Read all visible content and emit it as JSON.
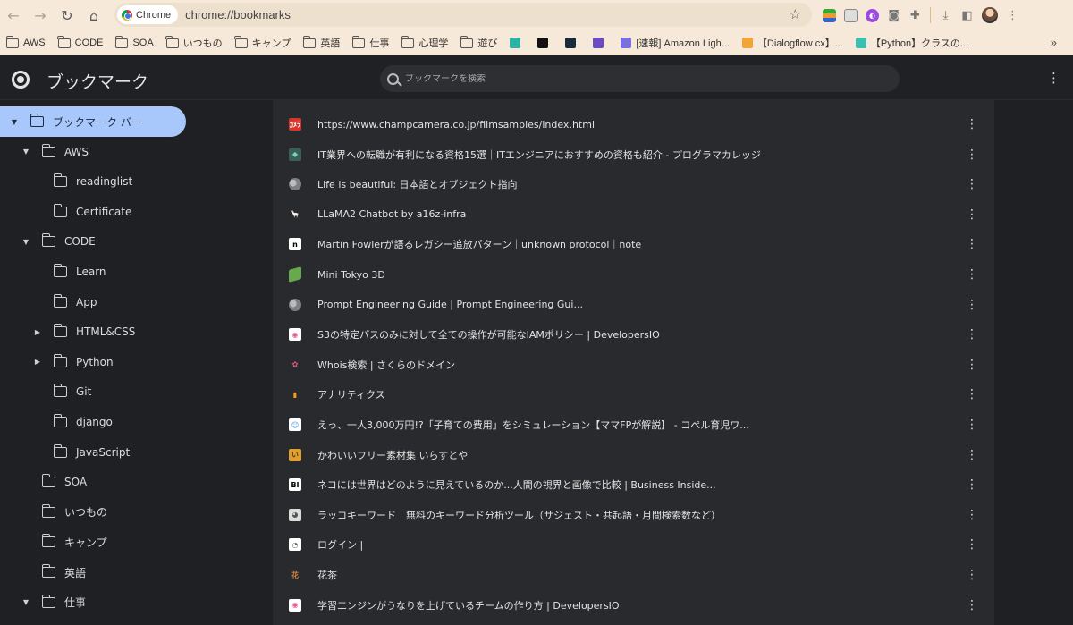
{
  "browser": {
    "chip_label": "Chrome",
    "url": "chrome://bookmarks"
  },
  "bookmarks_bar": [
    {
      "label": "AWS",
      "type": "folder"
    },
    {
      "label": "CODE",
      "type": "folder"
    },
    {
      "label": "SOA",
      "type": "folder"
    },
    {
      "label": "いつもの",
      "type": "folder"
    },
    {
      "label": "キャンプ",
      "type": "folder"
    },
    {
      "label": "英語",
      "type": "folder"
    },
    {
      "label": "仕事",
      "type": "folder"
    },
    {
      "label": "心理学",
      "type": "folder"
    },
    {
      "label": "遊び",
      "type": "folder"
    },
    {
      "label": "",
      "type": "icon",
      "color": "#2bb3a0"
    },
    {
      "label": "",
      "type": "icon",
      "color": "#111111"
    },
    {
      "label": "",
      "type": "icon",
      "color": "#1b2a3a"
    },
    {
      "label": "",
      "type": "icon",
      "color": "#6a4bc2"
    },
    {
      "label": "[速報] Amazon Ligh...",
      "type": "icon",
      "color": "#7a6ee0"
    },
    {
      "label": "【Dialogflow cx】...",
      "type": "icon",
      "color": "#f2a33a"
    },
    {
      "label": "【Python】クラスの...",
      "type": "icon",
      "color": "#3cbfae"
    }
  ],
  "header": {
    "title": "ブックマーク",
    "search_placeholder": "ブックマークを検索"
  },
  "tree": [
    {
      "label": "ブックマーク バー",
      "level": 0,
      "arrow": "▼",
      "selected": true
    },
    {
      "label": "AWS",
      "level": 1,
      "arrow": "▼",
      "selected": false
    },
    {
      "label": "readinglist",
      "level": 2,
      "arrow": "",
      "selected": false
    },
    {
      "label": "Certificate",
      "level": 2,
      "arrow": "",
      "selected": false
    },
    {
      "label": "CODE",
      "level": 1,
      "arrow": "▼",
      "selected": false
    },
    {
      "label": "Learn",
      "level": 2,
      "arrow": "",
      "selected": false
    },
    {
      "label": "App",
      "level": 2,
      "arrow": "",
      "selected": false
    },
    {
      "label": "HTML&CSS",
      "level": 2,
      "arrow": "▶",
      "selected": false
    },
    {
      "label": "Python",
      "level": 2,
      "arrow": "▶",
      "selected": false
    },
    {
      "label": "Git",
      "level": 2,
      "arrow": "",
      "selected": false
    },
    {
      "label": "django",
      "level": 2,
      "arrow": "",
      "selected": false
    },
    {
      "label": "JavaScript",
      "level": 2,
      "arrow": "",
      "selected": false
    },
    {
      "label": "SOA",
      "level": 1,
      "arrow": "",
      "selected": false
    },
    {
      "label": "いつもの",
      "level": 1,
      "arrow": "",
      "selected": false
    },
    {
      "label": "キャンプ",
      "level": 1,
      "arrow": "",
      "selected": false
    },
    {
      "label": "英語",
      "level": 1,
      "arrow": "",
      "selected": false
    },
    {
      "label": "仕事",
      "level": 1,
      "arrow": "▼",
      "selected": false
    }
  ],
  "list": [
    {
      "title": "https://www.champcamera.co.jp/filmsamples/index.html",
      "icon": "champ-camera-icon",
      "color": "#d8342b",
      "glyph": "ｶﾒﾗ",
      "fg": "#fff"
    },
    {
      "title": "IT業界への転職が有利になる資格15選｜ITエンジニアにおすすめの資格も紹介 - プログラマカレッジ",
      "icon": "programmer-college-icon",
      "color": "#3a5f55",
      "glyph": "◆",
      "fg": "#7fd1b9"
    },
    {
      "title": "Life is beautiful: 日本語とオブジェクト指向",
      "icon": "globe-icon",
      "color": "#5f6368",
      "glyph": "",
      "fg": "#fff"
    },
    {
      "title": "LLaMA2 Chatbot by a16z-infra",
      "icon": "llama-icon",
      "color": "#292a2d",
      "glyph": "🦙",
      "fg": "#d9a066"
    },
    {
      "title": "Martin Fowlerが語るレガシー追放パターン｜unknown protocol｜note",
      "icon": "note-icon",
      "color": "#ffffff",
      "glyph": "n",
      "fg": "#000"
    },
    {
      "title": "Mini Tokyo 3D",
      "icon": "mini-tokyo-icon",
      "color": "#6aa84f",
      "glyph": "",
      "fg": "#fff"
    },
    {
      "title": "Prompt Engineering Guide | Prompt Engineering Gui...",
      "icon": "globe-icon",
      "color": "#5f6368",
      "glyph": "",
      "fg": "#fff"
    },
    {
      "title": "S3の特定パスのみに対して全ての操作が可能なIAMポリシー | DevelopersIO",
      "icon": "developersio-icon",
      "color": "#ffffff",
      "glyph": "◉",
      "fg": "#e05a8a"
    },
    {
      "title": "Whois検索 | さくらのドメイン",
      "icon": "sakura-icon",
      "color": "#292a2d",
      "glyph": "✿",
      "fg": "#e8587a"
    },
    {
      "title": "アナリティクス",
      "icon": "analytics-icon",
      "color": "#292a2d",
      "glyph": "▮",
      "fg": "#f4a020"
    },
    {
      "title": "えっ、一人3,000万円!?「子育ての費用」をシミュレーション【ママFPが解説】 - コペル育児ワ...",
      "icon": "copel-icon",
      "color": "#ffffff",
      "glyph": "☺",
      "fg": "#3b8ee0"
    },
    {
      "title": "かわいいフリー素材集 いらすとや",
      "icon": "irasutoya-icon",
      "color": "#e0a030",
      "glyph": "い",
      "fg": "#5a3a10"
    },
    {
      "title": "ネコには世界はどのように見えているのか...人間の視界と画像で比較 | Business Inside...",
      "icon": "business-insider-icon",
      "color": "#ffffff",
      "glyph": "BI",
      "fg": "#000"
    },
    {
      "title": "ラッコキーワード｜無料のキーワード分析ツール（サジェスト・共起語・月間検索数など）",
      "icon": "rakko-icon",
      "color": "#dddddd",
      "glyph": "◕",
      "fg": "#555"
    },
    {
      "title": "ログイン |",
      "icon": "login-icon",
      "color": "#ffffff",
      "glyph": "◔",
      "fg": "#666"
    },
    {
      "title": "花茶",
      "icon": "hanacha-icon",
      "color": "#292a2d",
      "glyph": "花",
      "fg": "#d9823b"
    },
    {
      "title": "学習エンジンがうなりを上げているチームの作り方 | DevelopersIO",
      "icon": "developersio-icon",
      "color": "#ffffff",
      "glyph": "◉",
      "fg": "#e05a8a"
    }
  ]
}
